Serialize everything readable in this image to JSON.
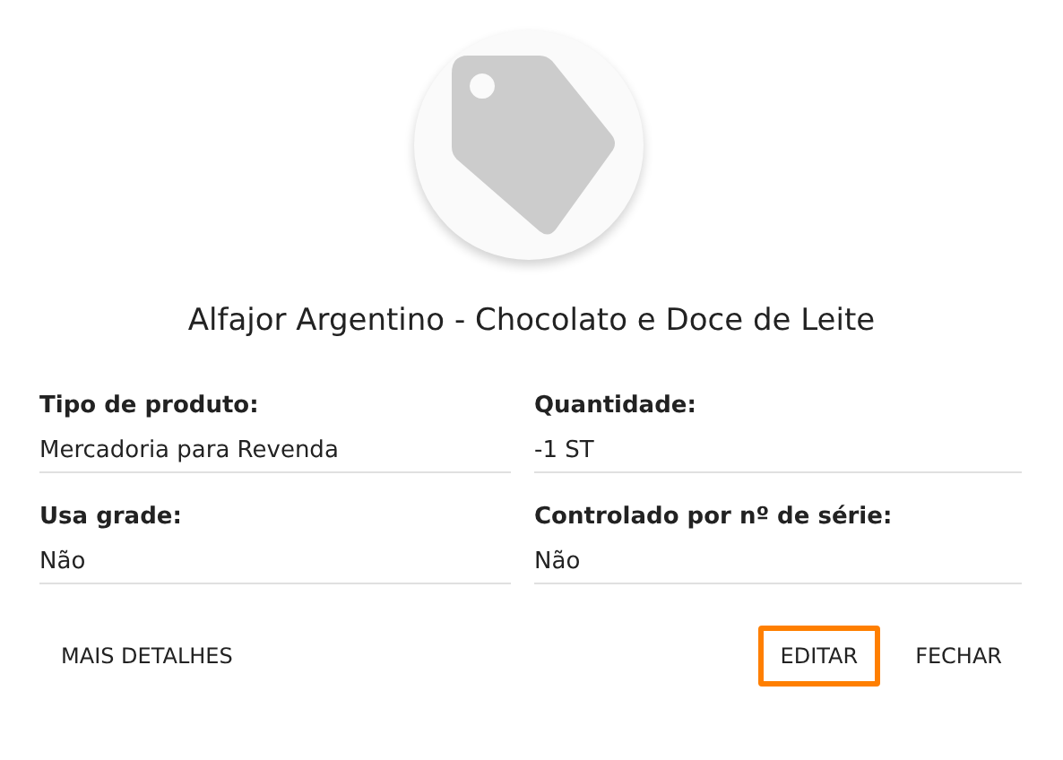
{
  "product": {
    "title": "Alfajor Argentino - Chocolato e Doce de Leite"
  },
  "fields": [
    {
      "label": "Tipo de produto:",
      "value": "Mercadoria para Revenda"
    },
    {
      "label": "Quantidade:",
      "value": "-1 ST"
    },
    {
      "label": "Usa grade:",
      "value": "Não"
    },
    {
      "label": "Controlado por nº de série:",
      "value": "Não"
    }
  ],
  "left_buttons": [
    {
      "label": "MAIS DETALHES",
      "focused": false
    }
  ],
  "right_buttons": [
    {
      "label": "EDITAR",
      "focused": true
    },
    {
      "label": "FECHAR",
      "focused": false
    }
  ]
}
